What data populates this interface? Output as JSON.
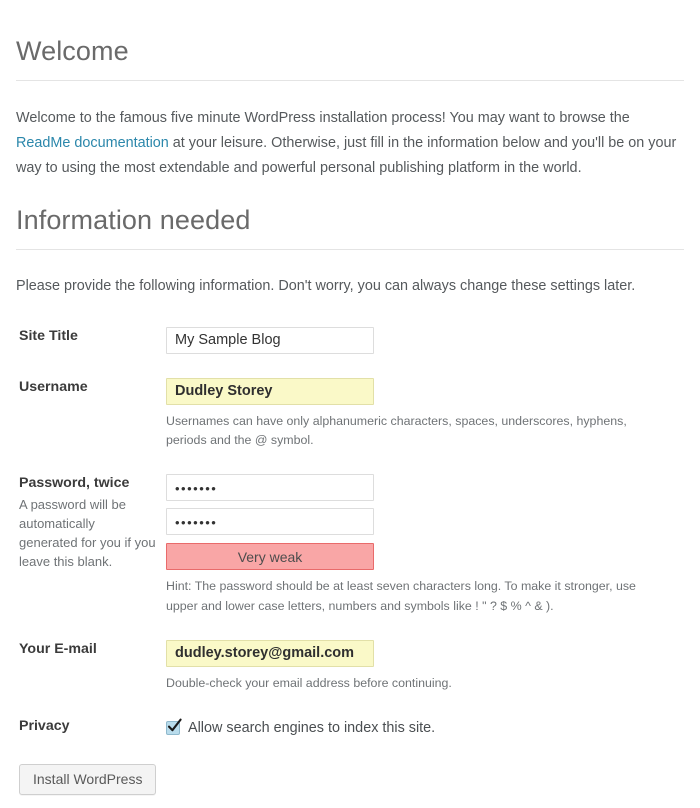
{
  "welcome": {
    "heading": "Welcome",
    "intro_before_link": "Welcome to the famous five minute WordPress installation process! You may want to browse the ",
    "link_text": "ReadMe documentation",
    "intro_after_link": " at your leisure. Otherwise, just fill in the information below and you'll be on your way to using the most extendable and powerful personal publishing platform in the world."
  },
  "info": {
    "heading": "Information needed",
    "description": "Please provide the following information. Don't worry, you can always change these settings later."
  },
  "fields": {
    "site_title": {
      "label": "Site Title",
      "value": "My Sample Blog"
    },
    "username": {
      "label": "Username",
      "value": "Dudley Storey",
      "hint": "Usernames can have only alphanumeric characters, spaces, underscores, hyphens, periods and the @ symbol."
    },
    "password": {
      "label": "Password, twice",
      "sublabel": "A password will be automatically generated for you if you leave this blank.",
      "value_1": "•••••••",
      "value_2": "•••••••",
      "strength_text": "Very weak",
      "hint": "Hint: The password should be at least seven characters long. To make it stronger, use upper and lower case letters, numbers and symbols like ! \" ? $ % ^ & )."
    },
    "email": {
      "label": "Your E-mail",
      "value": "dudley.storey@gmail.com",
      "hint": "Double-check your email address before continuing."
    },
    "privacy": {
      "label": "Privacy",
      "checkbox_caption": "Allow search engines to index this site.",
      "checked": true
    }
  },
  "submit": {
    "label": "Install WordPress"
  },
  "colors": {
    "link": "#2b87ab",
    "heading": "#6a6a6a",
    "autofill_background": "#faf9c8",
    "strength_background": "#f9a6a6",
    "strength_border": "#e96b6b",
    "input_border": "#dddddd"
  }
}
